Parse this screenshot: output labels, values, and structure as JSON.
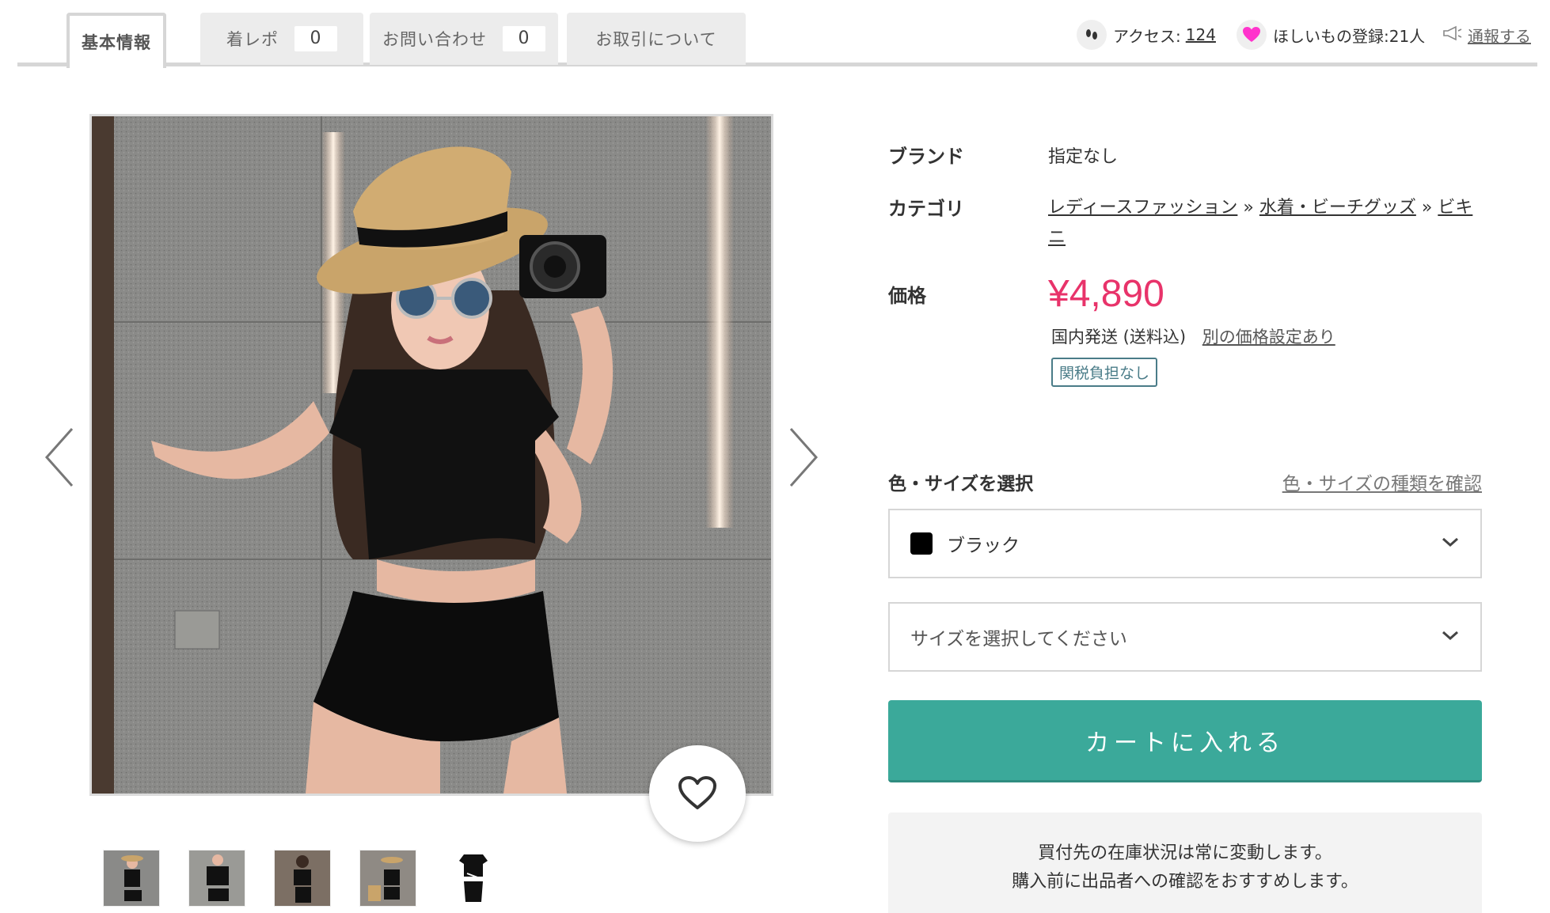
{
  "tabs": [
    {
      "label": "基本情報",
      "active": true
    },
    {
      "label": "着レポ",
      "count": "0"
    },
    {
      "label": "お問い合わせ",
      "count": "0"
    },
    {
      "label": "お取引について"
    }
  ],
  "meta": {
    "access_label": "アクセス:",
    "access_count": "124",
    "wish_label": "ほしいもの登録:21人",
    "report_label": "通報する"
  },
  "product": {
    "brand_label": "ブランド",
    "brand_value": "指定なし",
    "category_label": "カテゴリ",
    "categories": [
      "レディースファッション",
      "水着・ビーチグッズ",
      "ビキニ"
    ],
    "category_sep": "»",
    "price_label": "価格",
    "price": "¥4,890",
    "shipping": "国内発送 (送料込)",
    "alt_price_link": "別の価格設定あり",
    "tax_badge": "関税負担なし"
  },
  "selection": {
    "title": "色・サイズを選択",
    "check_link": "色・サイズの種類を確認",
    "color_value": "ブラック",
    "size_placeholder": "サイズを選択してください"
  },
  "cart_button": "カートに入れる",
  "notice": {
    "line1": "買付先の在庫状況は常に変動します。",
    "line2": "購入前に出品者への確認をおすすめします。"
  },
  "colors": {
    "price": "#e8336a",
    "cart": "#3ba99a",
    "heart_icon": "#ff33cc"
  }
}
